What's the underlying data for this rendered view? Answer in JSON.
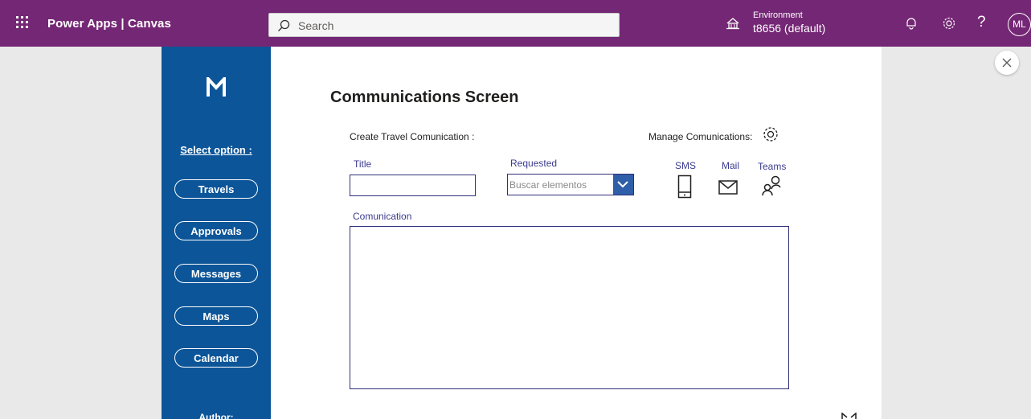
{
  "topbar": {
    "app_title": "Power Apps  |  Canvas",
    "search_placeholder": "Search",
    "environment_label": "Environment",
    "environment_value": "t8656 (default)",
    "help_label": "?",
    "avatar_initials": "ML",
    "background_color": "#742774"
  },
  "sidebar": {
    "select_option": "Select option :",
    "items": [
      {
        "label": "Travels"
      },
      {
        "label": "Approvals"
      },
      {
        "label": "Messages"
      },
      {
        "label": "Maps"
      },
      {
        "label": "Calendar"
      }
    ],
    "author_label": "Author:",
    "background_color": "#0c5598"
  },
  "main": {
    "screen_title": "Communications Screen",
    "create_label": "Create Travel Comunication :",
    "manage_label": "Manage Comunications:",
    "title_label": "Title",
    "title_value": "",
    "requested_label": "Requested",
    "requested_placeholder": "Buscar elementos",
    "channels": [
      {
        "label": "SMS",
        "icon": "phone-icon"
      },
      {
        "label": "Mail",
        "icon": "mail-icon"
      },
      {
        "label": "Teams",
        "icon": "people-icon"
      }
    ],
    "communication_label": "Comunication",
    "communication_value": ""
  }
}
